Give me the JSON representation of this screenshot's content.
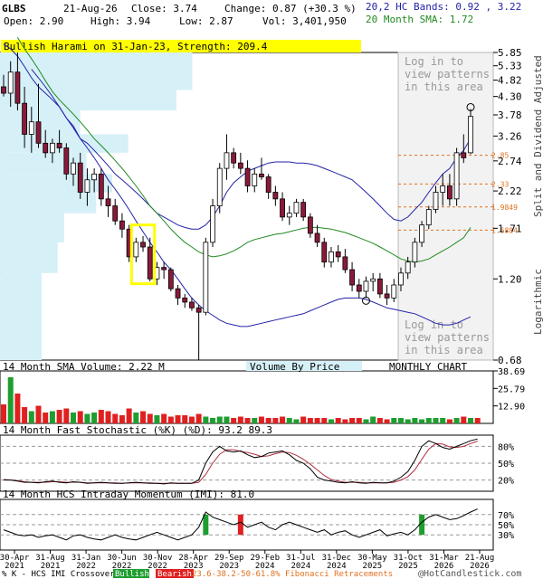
{
  "header": {
    "ticker": "GLBS",
    "date": "21-Aug-26",
    "close_label": "Close: 3.74",
    "change_label": "Change: 0.87 (+30.3 %)",
    "open_label": "Open: 2.90",
    "high_label": "High: 3.94",
    "low_label": "Low: 2.87",
    "vol_label": "Vol: 3,401,950",
    "bands_label": "20,2 HC Bands: 0.92 , 3.22",
    "sma_label": "20 Month SMA: 1.72"
  },
  "pattern_banner": "Bullish Harami on 31-Jan-23, Strength: 209.4",
  "watermark": [
    "Log in to",
    "view patterns",
    "in this area"
  ],
  "right_axis_title": "Split and Dividend Adjusted",
  "right_axis_scale": "Logarithmic",
  "volume_labels": {
    "sma": "14 Month SMA Volume: 2.22 M",
    "vbp": "Volume By Price",
    "chart_type": "MONTHLY CHART"
  },
  "stoch_label": "14 Month Fast Stochastic (%K) (%D): 93.2  89.3",
  "imi_label": "14 Month HCS Intraday Momentum (IMI): 81.0",
  "footer": {
    "k_label": "% K - HCS IMI Crossover,",
    "bullish": "Bullish",
    "bearish": "Bearish",
    "fib": "23.6-38.2-50-61.8% Fibonacci Retracements",
    "copyright": "@HotCandlestick.com"
  },
  "colors": {
    "up": "#ffffff",
    "down": "#8b1a3a",
    "bands": "#2323a8",
    "sma": "#208a20",
    "vbp": "#d6f0f8",
    "banner": "#ffff00",
    "bull": "#1e9e30",
    "bear": "#e02020",
    "fib": "#e07020"
  },
  "chart_data": {
    "type": "candlestick",
    "interval": "monthly",
    "x_tick_labels": [
      "30-Apr\n2021",
      "31-Aug\n2021",
      "31-Jan\n2022",
      "30-Jun\n2022",
      "30-Nov\n2022",
      "28-Apr\n2023",
      "29-Sep\n2023",
      "29-Feb\n2024",
      "31-Jul\n2024",
      "31-Dec\n2024",
      "30-May\n2025",
      "31-Oct\n2025",
      "31-Mar\n2026",
      "21-Aug\n2026"
    ],
    "y_scale": "log",
    "ylim": [
      0.68,
      5.85
    ],
    "y_ticks": [
      5.85,
      5.33,
      4.82,
      4.3,
      3.78,
      3.26,
      2.74,
      2.22,
      1.71,
      1.2,
      0.68
    ],
    "fib_levels": [
      2.85,
      2.33,
      1.9849,
      1.6884
    ],
    "candles": [
      {
        "o": 4.6,
        "h": 5.0,
        "l": 4.3,
        "c": 4.4
      },
      {
        "o": 4.4,
        "h": 5.5,
        "l": 4.0,
        "c": 5.1
      },
      {
        "o": 5.1,
        "h": 5.85,
        "l": 3.9,
        "c": 4.1
      },
      {
        "o": 4.1,
        "h": 4.6,
        "l": 3.0,
        "c": 3.3
      },
      {
        "o": 3.3,
        "h": 4.0,
        "l": 2.9,
        "c": 3.6
      },
      {
        "o": 3.6,
        "h": 4.7,
        "l": 3.0,
        "c": 3.1
      },
      {
        "o": 3.1,
        "h": 3.4,
        "l": 2.8,
        "c": 2.9
      },
      {
        "o": 2.9,
        "h": 3.2,
        "l": 2.7,
        "c": 3.1
      },
      {
        "o": 3.1,
        "h": 3.4,
        "l": 2.9,
        "c": 3.0
      },
      {
        "o": 3.0,
        "h": 3.1,
        "l": 2.4,
        "c": 2.5
      },
      {
        "o": 2.5,
        "h": 2.8,
        "l": 2.3,
        "c": 2.7
      },
      {
        "o": 2.7,
        "h": 2.9,
        "l": 2.1,
        "c": 2.2
      },
      {
        "o": 2.2,
        "h": 2.6,
        "l": 2.0,
        "c": 2.4
      },
      {
        "o": 2.4,
        "h": 2.6,
        "l": 2.2,
        "c": 2.5
      },
      {
        "o": 2.5,
        "h": 2.6,
        "l": 2.0,
        "c": 2.1
      },
      {
        "o": 2.1,
        "h": 2.3,
        "l": 1.85,
        "c": 2.0
      },
      {
        "o": 2.0,
        "h": 2.1,
        "l": 1.75,
        "c": 1.8
      },
      {
        "o": 1.8,
        "h": 1.9,
        "l": 1.6,
        "c": 1.7
      },
      {
        "o": 1.7,
        "h": 1.75,
        "l": 1.35,
        "c": 1.4
      },
      {
        "o": 1.4,
        "h": 1.6,
        "l": 1.35,
        "c": 1.55
      },
      {
        "o": 1.55,
        "h": 1.62,
        "l": 1.45,
        "c": 1.5
      },
      {
        "o": 1.5,
        "h": 1.6,
        "l": 1.18,
        "c": 1.2
      },
      {
        "o": 1.2,
        "h": 1.35,
        "l": 1.15,
        "c": 1.3
      },
      {
        "o": 1.3,
        "h": 1.35,
        "l": 1.2,
        "c": 1.28
      },
      {
        "o": 1.28,
        "h": 1.3,
        "l": 1.1,
        "c": 1.12
      },
      {
        "o": 1.12,
        "h": 1.15,
        "l": 1.0,
        "c": 1.05
      },
      {
        "o": 1.05,
        "h": 1.08,
        "l": 0.98,
        "c": 1.02
      },
      {
        "o": 1.02,
        "h": 1.05,
        "l": 0.96,
        "c": 0.98
      },
      {
        "o": 0.98,
        "h": 1.0,
        "l": 0.68,
        "c": 0.95
      },
      {
        "o": 0.95,
        "h": 1.6,
        "l": 0.93,
        "c": 1.55
      },
      {
        "o": 1.55,
        "h": 2.1,
        "l": 1.5,
        "c": 2.0
      },
      {
        "o": 2.0,
        "h": 2.7,
        "l": 1.9,
        "c": 2.6
      },
      {
        "o": 2.6,
        "h": 3.3,
        "l": 2.4,
        "c": 2.9
      },
      {
        "o": 2.9,
        "h": 3.0,
        "l": 2.6,
        "c": 2.7
      },
      {
        "o": 2.7,
        "h": 2.9,
        "l": 2.5,
        "c": 2.6
      },
      {
        "o": 2.6,
        "h": 2.75,
        "l": 2.2,
        "c": 2.3
      },
      {
        "o": 2.3,
        "h": 2.6,
        "l": 2.2,
        "c": 2.5
      },
      {
        "o": 2.5,
        "h": 2.8,
        "l": 2.4,
        "c": 2.45
      },
      {
        "o": 2.45,
        "h": 2.5,
        "l": 2.1,
        "c": 2.2
      },
      {
        "o": 2.2,
        "h": 2.3,
        "l": 2.0,
        "c": 2.1
      },
      {
        "o": 2.1,
        "h": 2.2,
        "l": 1.8,
        "c": 1.85
      },
      {
        "o": 1.85,
        "h": 2.0,
        "l": 1.75,
        "c": 1.9
      },
      {
        "o": 1.9,
        "h": 2.1,
        "l": 1.85,
        "c": 2.05
      },
      {
        "o": 2.05,
        "h": 2.1,
        "l": 1.8,
        "c": 1.85
      },
      {
        "o": 1.85,
        "h": 1.9,
        "l": 1.6,
        "c": 1.65
      },
      {
        "o": 1.65,
        "h": 1.75,
        "l": 1.5,
        "c": 1.55
      },
      {
        "o": 1.55,
        "h": 1.6,
        "l": 1.3,
        "c": 1.35
      },
      {
        "o": 1.35,
        "h": 1.5,
        "l": 1.3,
        "c": 1.45
      },
      {
        "o": 1.45,
        "h": 1.52,
        "l": 1.35,
        "c": 1.4
      },
      {
        "o": 1.4,
        "h": 1.48,
        "l": 1.25,
        "c": 1.28
      },
      {
        "o": 1.28,
        "h": 1.35,
        "l": 1.1,
        "c": 1.15
      },
      {
        "o": 1.15,
        "h": 1.2,
        "l": 1.05,
        "c": 1.1
      },
      {
        "o": 1.1,
        "h": 1.22,
        "l": 1.05,
        "c": 1.18
      },
      {
        "o": 1.18,
        "h": 1.25,
        "l": 1.1,
        "c": 1.2
      },
      {
        "o": 1.2,
        "h": 1.25,
        "l": 1.05,
        "c": 1.08
      },
      {
        "o": 1.08,
        "h": 1.15,
        "l": 1.0,
        "c": 1.05
      },
      {
        "o": 1.05,
        "h": 1.2,
        "l": 1.02,
        "c": 1.15
      },
      {
        "o": 1.15,
        "h": 1.3,
        "l": 1.1,
        "c": 1.25
      },
      {
        "o": 1.25,
        "h": 1.4,
        "l": 1.2,
        "c": 1.35
      },
      {
        "o": 1.35,
        "h": 1.6,
        "l": 1.3,
        "c": 1.55
      },
      {
        "o": 1.55,
        "h": 1.8,
        "l": 1.5,
        "c": 1.75
      },
      {
        "o": 1.75,
        "h": 2.0,
        "l": 1.7,
        "c": 1.95
      },
      {
        "o": 1.95,
        "h": 2.3,
        "l": 1.9,
        "c": 2.2
      },
      {
        "o": 2.2,
        "h": 2.5,
        "l": 2.0,
        "c": 2.3
      },
      {
        "o": 2.3,
        "h": 2.5,
        "l": 2.0,
        "c": 2.1
      },
      {
        "o": 2.1,
        "h": 3.0,
        "l": 2.0,
        "c": 2.9
      },
      {
        "o": 2.9,
        "h": 3.3,
        "l": 2.7,
        "c": 2.8
      },
      {
        "o": 2.9,
        "h": 3.94,
        "l": 2.87,
        "c": 3.74
      }
    ],
    "upper_band": [
      6.2,
      6.0,
      5.7,
      5.3,
      4.9,
      4.6,
      4.4,
      4.2,
      4.0,
      3.7,
      3.5,
      3.2,
      3.1,
      2.95,
      2.8,
      2.65,
      2.5,
      2.4,
      2.3,
      2.2,
      2.1,
      2.0,
      1.9,
      1.85,
      1.8,
      1.75,
      1.72,
      1.7,
      1.7,
      1.75,
      1.85,
      2.0,
      2.2,
      2.35,
      2.45,
      2.55,
      2.6,
      2.65,
      2.7,
      2.72,
      2.72,
      2.72,
      2.7,
      2.7,
      2.68,
      2.65,
      2.6,
      2.55,
      2.5,
      2.45,
      2.4,
      2.3,
      2.2,
      2.1,
      2.0,
      1.9,
      1.82,
      1.8,
      1.85,
      1.95,
      2.05,
      2.2,
      2.35,
      2.5,
      2.6,
      2.8,
      2.95,
      3.2
    ],
    "sma": [
      6.5,
      6.0,
      5.6,
      5.2,
      4.8,
      4.45,
      4.2,
      4.0,
      3.8,
      3.6,
      3.4,
      3.2,
      3.05,
      2.9,
      2.75,
      2.6,
      2.45,
      2.3,
      2.15,
      2.0,
      1.9,
      1.8,
      1.7,
      1.62,
      1.55,
      1.5,
      1.45,
      1.42,
      1.4,
      1.41,
      1.43,
      1.46,
      1.5,
      1.55,
      1.58,
      1.6,
      1.62,
      1.64,
      1.65,
      1.67,
      1.69,
      1.71,
      1.72,
      1.72,
      1.71,
      1.7,
      1.68,
      1.66,
      1.63,
      1.6,
      1.57,
      1.54,
      1.5,
      1.46,
      1.42,
      1.38,
      1.36,
      1.35,
      1.36,
      1.38,
      1.42,
      1.46,
      1.5,
      1.55,
      1.6,
      1.72
    ],
    "lower_band": [
      5.2,
      4.9,
      4.6,
      4.3,
      4.0,
      3.7,
      3.45,
      3.2,
      3.0,
      2.8,
      2.6,
      2.4,
      2.25,
      2.1,
      1.95,
      1.8,
      1.67,
      1.55,
      1.45,
      1.35,
      1.28,
      1.2,
      1.12,
      1.05,
      1.0,
      0.96,
      0.93,
      0.9,
      0.88,
      0.87,
      0.86,
      0.86,
      0.87,
      0.88,
      0.89,
      0.9,
      0.91,
      0.92,
      0.93,
      0.94,
      0.96,
      0.98,
      1.0,
      1.02,
      1.04,
      1.05,
      1.05,
      1.05,
      1.04,
      1.02,
      1.0,
      0.98,
      0.97,
      0.96,
      0.95,
      0.94,
      0.92,
      0.9,
      0.88,
      0.87,
      0.87,
      0.88,
      0.9,
      0.92
    ],
    "volume": {
      "ylim": [
        0,
        38.69
      ],
      "y_ticks": [
        38.69,
        25.79,
        12.9
      ],
      "values": [
        14,
        34,
        22,
        12,
        9,
        13,
        8,
        9,
        10,
        11,
        8,
        9,
        7,
        8,
        10,
        9,
        7,
        6,
        11,
        8,
        9,
        7,
        6,
        7,
        5,
        6,
        6,
        5,
        7,
        5,
        4,
        5,
        5,
        4,
        5,
        4,
        4,
        5,
        4,
        4,
        5,
        4,
        3,
        5,
        4,
        4,
        4,
        3,
        4,
        3,
        4,
        4,
        3,
        5,
        4,
        3,
        4,
        4,
        3,
        4,
        3,
        4,
        4,
        4,
        3,
        4,
        5,
        4,
        4
      ]
    },
    "vbp": {
      "zones": [
        {
          "lo": 4.5,
          "hi": 5.85,
          "w": 0.6
        },
        {
          "lo": 3.9,
          "hi": 4.5,
          "w": 0.55
        },
        {
          "lo": 3.3,
          "hi": 3.9,
          "w": 0.25
        },
        {
          "lo": 2.9,
          "hi": 3.3,
          "w": 0.4
        },
        {
          "lo": 2.5,
          "hi": 2.9,
          "w": 0.27
        },
        {
          "lo": 2.2,
          "hi": 2.5,
          "w": 0.35
        },
        {
          "lo": 1.9,
          "hi": 2.2,
          "w": 0.3
        },
        {
          "lo": 1.55,
          "hi": 1.9,
          "w": 0.2
        },
        {
          "lo": 1.25,
          "hi": 1.55,
          "w": 0.18
        },
        {
          "lo": 0.68,
          "hi": 1.25,
          "w": 0.13
        }
      ]
    },
    "stochastic": {
      "ylim": [
        0,
        100
      ],
      "y_ticks": [
        80,
        50,
        20
      ],
      "k": [
        20,
        20,
        18,
        16,
        16,
        15,
        17,
        18,
        16,
        15,
        17,
        16,
        14,
        15,
        16,
        15,
        14,
        14,
        15,
        16,
        15,
        14,
        14,
        13,
        15,
        14,
        14,
        14,
        20,
        50,
        70,
        80,
        72,
        70,
        72,
        65,
        60,
        62,
        68,
        70,
        72,
        65,
        55,
        50,
        40,
        25,
        20,
        18,
        16,
        15,
        17,
        15,
        14,
        16,
        15,
        15,
        18,
        25,
        35,
        55,
        80,
        90,
        85,
        78,
        75,
        80,
        85,
        90,
        93.2
      ],
      "d": [
        21,
        20,
        19,
        17,
        16,
        16,
        16,
        17,
        17,
        16,
        16,
        16,
        15,
        15,
        15,
        15,
        15,
        14,
        15,
        15,
        15,
        15,
        14,
        14,
        14,
        14,
        14,
        14,
        16,
        30,
        50,
        66,
        74,
        74,
        71,
        69,
        66,
        62,
        63,
        67,
        70,
        69,
        64,
        57,
        48,
        38,
        28,
        21,
        18,
        16,
        16,
        16,
        15,
        15,
        15,
        15,
        16,
        20,
        26,
        38,
        57,
        75,
        85,
        84,
        79,
        78,
        80,
        85,
        89.3
      ]
    },
    "imi": {
      "ylim": [
        0,
        100
      ],
      "y_ticks": [
        70,
        50,
        30
      ],
      "values": [
        40,
        35,
        30,
        28,
        30,
        25,
        28,
        30,
        25,
        20,
        28,
        30,
        25,
        22,
        20,
        25,
        30,
        25,
        22,
        20,
        25,
        30,
        35,
        30,
        25,
        20,
        25,
        30,
        45,
        75,
        65,
        60,
        55,
        50,
        55,
        45,
        50,
        55,
        45,
        40,
        50,
        55,
        50,
        45,
        40,
        35,
        40,
        30,
        35,
        38,
        30,
        25,
        30,
        35,
        40,
        28,
        32,
        35,
        30,
        40,
        55,
        65,
        70,
        65,
        60,
        62,
        68,
        75,
        81.0
      ],
      "bull_markers": [
        29,
        60
      ],
      "bear_markers": [
        34
      ]
    }
  }
}
